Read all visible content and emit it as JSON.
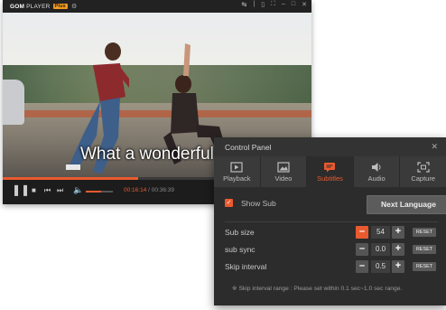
{
  "player": {
    "brand": "GOM",
    "brand_rest": "PLAYER",
    "plus_badge": "Plus",
    "subtitle_text": "What a wonderful d",
    "time_current": "00:16:14",
    "time_separator": " / ",
    "time_total": "00:36:39",
    "progress": 0.44,
    "volume": 0.55,
    "accent": "#ea5a2f"
  },
  "panel": {
    "title": "Control Panel",
    "close_icon": "close-icon",
    "tabs": [
      {
        "label": "Playback",
        "icon": "playback-icon"
      },
      {
        "label": "Video",
        "icon": "video-icon"
      },
      {
        "label": "Subtitles",
        "icon": "subtitles-icon",
        "active": true
      },
      {
        "label": "Audio",
        "icon": "audio-icon"
      },
      {
        "label": "Capture",
        "icon": "capture-icon"
      }
    ],
    "show_sub_label": "Show Sub",
    "show_sub_checked": true,
    "next_language_label": "Next Language",
    "settings": [
      {
        "label": "Sub size",
        "value": "54",
        "reset": "RESET"
      },
      {
        "label": "sub sync",
        "value": "0.0",
        "reset": "RESET"
      },
      {
        "label": "Skip interval",
        "value": "0.5",
        "reset": "RESET"
      }
    ],
    "note": "※ Skip interval range : Please set within 0.1 sec~1.0 sec range."
  }
}
